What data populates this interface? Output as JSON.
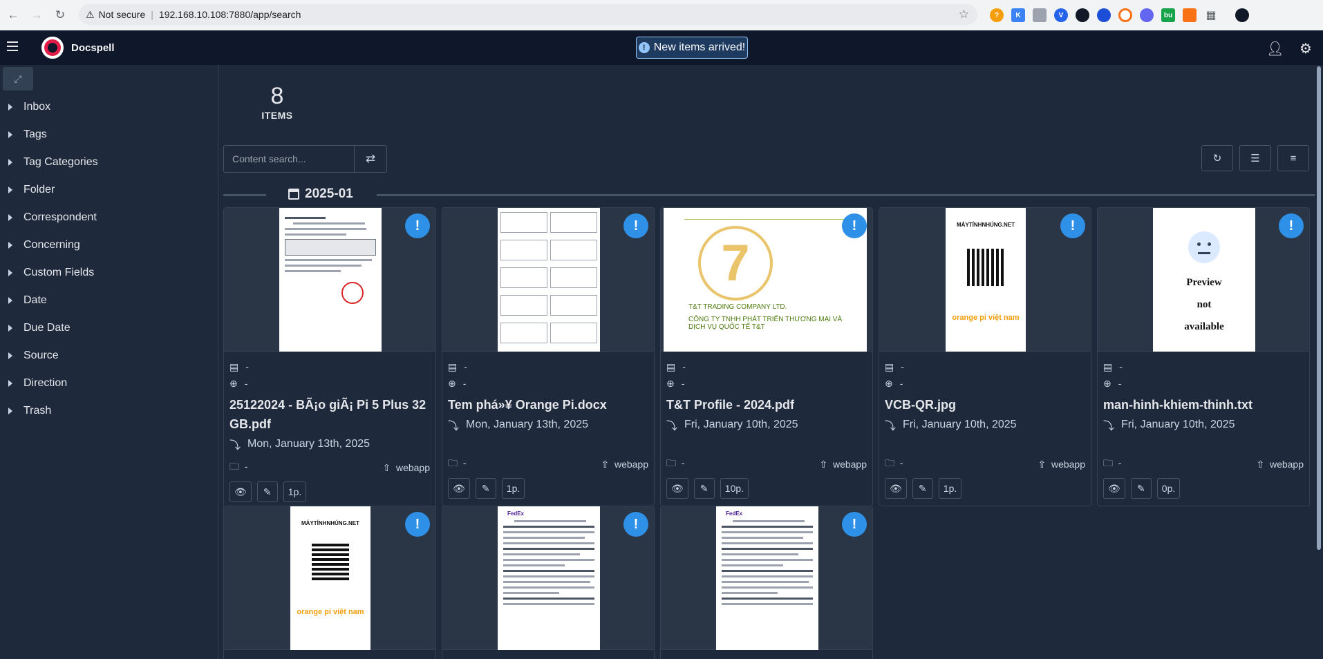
{
  "browser": {
    "not_secure": "Not secure",
    "url": "192.168.10.108:7880/app/search"
  },
  "app": {
    "name": "Docspell",
    "notification": "New items arrived!"
  },
  "sidebar": {
    "items": [
      "Inbox",
      "Tags",
      "Tag Categories",
      "Folder",
      "Correspondent",
      "Concerning",
      "Custom Fields",
      "Date",
      "Due Date",
      "Source",
      "Direction",
      "Trash"
    ]
  },
  "summary": {
    "count": "8",
    "label": "ITEMS"
  },
  "search": {
    "placeholder": "Content search..."
  },
  "group": {
    "label": "2025-01"
  },
  "items": [
    {
      "correspondent": "-",
      "concerning": "-",
      "title": "25122024 - BÃ¡o giÃ¡ Pi 5 Plus 32 GB.pdf",
      "date": "Mon, January 13th, 2025",
      "folder": "-",
      "source": "webapp",
      "pages": "1p."
    },
    {
      "correspondent": "-",
      "concerning": "-",
      "title": "Tem phá»¥ Orange Pi.docx",
      "date": "Mon, January 13th, 2025",
      "folder": "-",
      "source": "webapp",
      "pages": "1p."
    },
    {
      "correspondent": "-",
      "concerning": "-",
      "title": "T&T Profile - 2024.pdf",
      "date": "Fri, January 10th, 2025",
      "folder": "-",
      "source": "webapp",
      "pages": "10p.",
      "preview_text_1": "T&T TRADING COMPANY LTD.",
      "preview_text_2": "CÔNG TY TNHH PHÁT TRIỂN THƯƠNG MẠI VÀ DỊCH VỤ QUỐC TẾ T&T"
    },
    {
      "correspondent": "-",
      "concerning": "-",
      "title": "VCB-QR.jpg",
      "date": "Fri, January 10th, 2025",
      "folder": "-",
      "source": "webapp",
      "pages": "1p.",
      "preview_text_1": "MÁYTÍNHNHÚNG.NET",
      "preview_text_2": "orange pi việt nam"
    },
    {
      "correspondent": "-",
      "concerning": "-",
      "title": "man-hinh-khiem-thinh.txt",
      "date": "Fri, January 10th, 2025",
      "folder": "-",
      "source": "webapp",
      "pages": "0p.",
      "preview_text_1": "Preview",
      "preview_text_2": "not",
      "preview_text_3": "available"
    }
  ],
  "row2_previews": [
    {
      "preview_text_1": "MÁYTÍNHNHÚNG.NET",
      "preview_text_2": "orange pi việt nam"
    },
    {
      "preview_text_1": "FedEx"
    },
    {
      "preview_text_1": "FedEx"
    }
  ]
}
